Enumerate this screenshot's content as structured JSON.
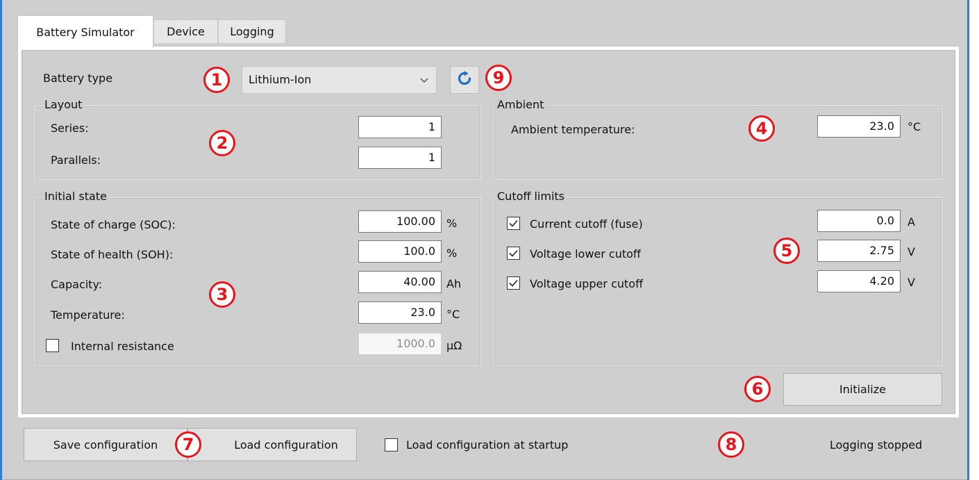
{
  "tabs": [
    {
      "label": "Battery Simulator",
      "active": true
    },
    {
      "label": "Device",
      "active": false
    },
    {
      "label": "Logging",
      "active": false
    }
  ],
  "battery_type": {
    "label": "Battery type",
    "selected": "Lithium-Ion",
    "refresh_icon": "refresh-icon"
  },
  "layout": {
    "title": "Layout",
    "series_label": "Series:",
    "series_value": "1",
    "parallels_label": "Parallels:",
    "parallels_value": "1"
  },
  "ambient": {
    "title": "Ambient",
    "temp_label": "Ambient temperature:",
    "temp_value": "23.0",
    "temp_unit": "°C"
  },
  "initial_state": {
    "title": "Initial state",
    "soc_label": "State of charge (SOC):",
    "soc_value": "100.00",
    "soc_unit": "%",
    "soh_label": "State of health (SOH):",
    "soh_value": "100.0",
    "soh_unit": "%",
    "capacity_label": "Capacity:",
    "capacity_value": "40.00",
    "capacity_unit": "Ah",
    "temperature_label": "Temperature:",
    "temperature_value": "23.0",
    "temperature_unit": "°C",
    "resistance_label": "Internal resistance",
    "resistance_checked": false,
    "resistance_value": "1000.0",
    "resistance_unit": "µΩ"
  },
  "cutoff": {
    "title": "Cutoff limits",
    "current_label": "Current cutoff (fuse)",
    "current_checked": true,
    "current_value": "0.0",
    "current_unit": "A",
    "vlow_label": "Voltage lower cutoff",
    "vlow_checked": true,
    "vlow_value": "2.75",
    "vlow_unit": "V",
    "vhigh_label": "Voltage upper cutoff",
    "vhigh_checked": true,
    "vhigh_value": "4.20",
    "vhigh_unit": "V"
  },
  "initialize_label": "Initialize",
  "footer": {
    "save_label": "Save configuration",
    "load_label": "Load configuration",
    "startup_label": "Load configuration at startup",
    "startup_checked": false,
    "status": "Logging stopped"
  },
  "callouts": [
    "1",
    "2",
    "3",
    "4",
    "5",
    "6",
    "7",
    "8",
    "9"
  ],
  "colors": {
    "callout": "#e8141b",
    "window_border": "#2d7fd3",
    "refresh_icon": "#1a6fc2"
  }
}
